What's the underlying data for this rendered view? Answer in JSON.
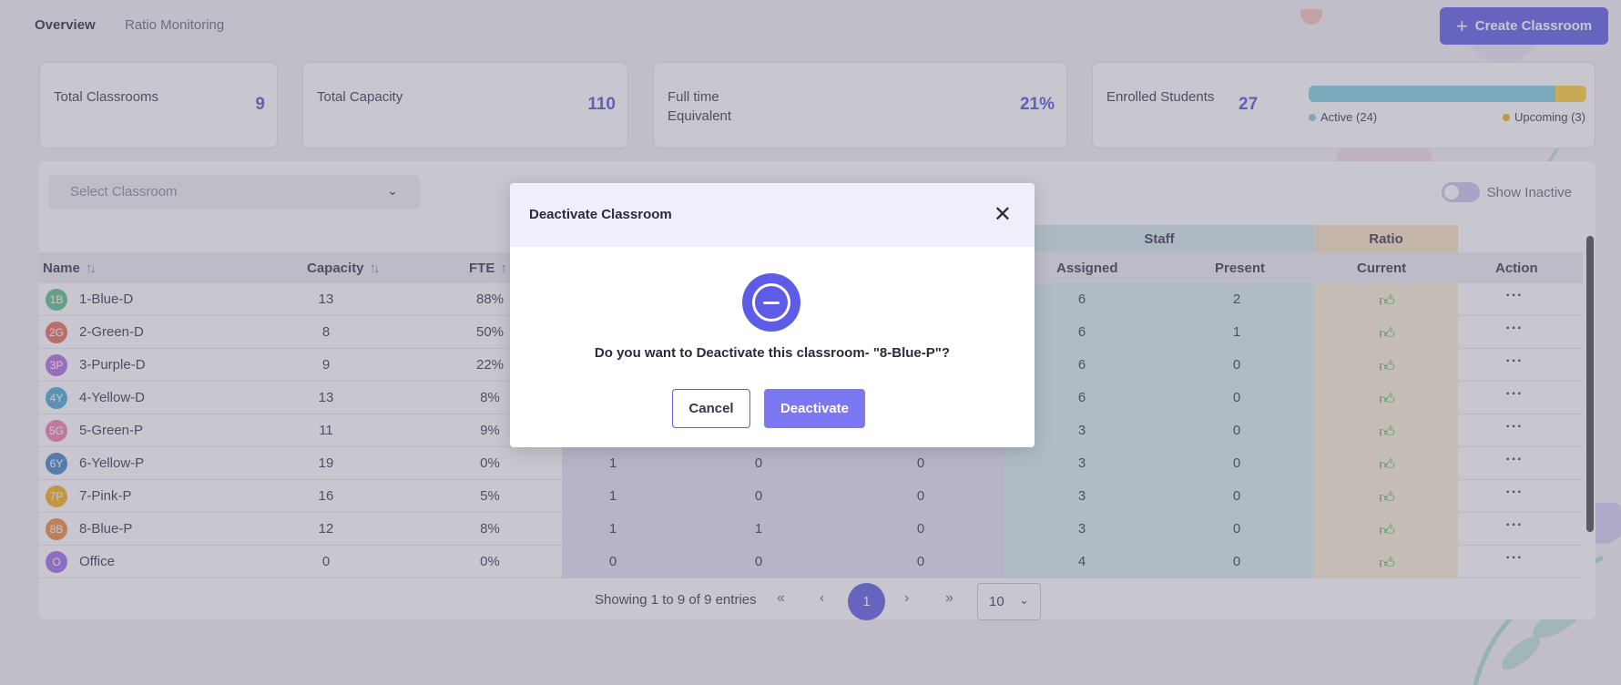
{
  "tabs": [
    {
      "label": "Overview",
      "active": true
    },
    {
      "label": "Ratio Monitoring",
      "active": false
    }
  ],
  "create_button": {
    "label": "Create Classroom",
    "icon": "plus-icon"
  },
  "stats": {
    "total_classrooms": {
      "label": "Total Classrooms",
      "value": "9"
    },
    "total_capacity": {
      "label": "Total Capacity",
      "value": "110"
    },
    "fte": {
      "label": "Full time Equivalent",
      "value": "21%"
    },
    "enrolled": {
      "label": "Enrolled Students",
      "value": "27",
      "active_label": "Active (24)",
      "upcoming_label": "Upcoming (3)",
      "active": 24,
      "upcoming": 3,
      "colors": {
        "active": "#7fd0e3",
        "upcoming": "#ffcf34"
      }
    }
  },
  "filter": {
    "placeholder": "Select Classroom",
    "show_inactive_label": "Show Inactive",
    "show_inactive": false
  },
  "table": {
    "group_headers": {
      "staff": "Staff",
      "ratio": "Ratio"
    },
    "columns": {
      "name": "Name",
      "capacity": "Capacity",
      "fte": "FTE",
      "assigned": "Assigned",
      "present": "Present",
      "current": "Current",
      "action": "Action"
    },
    "rows": [
      {
        "badge": "1B",
        "badge_color": "#5dbf8a",
        "name": "1-Blue-D",
        "capacity": "13",
        "fte": "88%",
        "c1": "",
        "c2": "",
        "c3": "",
        "assigned": "6",
        "present": "2"
      },
      {
        "badge": "2G",
        "badge_color": "#e76d5a",
        "name": "2-Green-D",
        "capacity": "8",
        "fte": "50%",
        "c1": "",
        "c2": "",
        "c3": "",
        "assigned": "6",
        "present": "1"
      },
      {
        "badge": "3P",
        "badge_color": "#b06be0",
        "name": "3-Purple-D",
        "capacity": "9",
        "fte": "22%",
        "c1": "",
        "c2": "",
        "c3": "",
        "assigned": "6",
        "present": "0"
      },
      {
        "badge": "4Y",
        "badge_color": "#4aa9d6",
        "name": "4-Yellow-D",
        "capacity": "13",
        "fte": "8%",
        "c1": "",
        "c2": "",
        "c3": "",
        "assigned": "6",
        "present": "0"
      },
      {
        "badge": "5G",
        "badge_color": "#f27fb0",
        "name": "5-Green-P",
        "capacity": "11",
        "fte": "9%",
        "c1": "",
        "c2": "",
        "c3": "",
        "assigned": "3",
        "present": "0"
      },
      {
        "badge": "6Y",
        "badge_color": "#3e84c8",
        "name": "6-Yellow-P",
        "capacity": "19",
        "fte": "0%",
        "c1": "1",
        "c2": "0",
        "c3": "0",
        "assigned": "3",
        "present": "0"
      },
      {
        "badge": "7P",
        "badge_color": "#f2b21b",
        "name": "7-Pink-P",
        "capacity": "16",
        "fte": "5%",
        "c1": "1",
        "c2": "0",
        "c3": "0",
        "assigned": "3",
        "present": "0"
      },
      {
        "badge": "8B",
        "badge_color": "#f08a3a",
        "name": "8-Blue-P",
        "capacity": "12",
        "fte": "8%",
        "c1": "1",
        "c2": "1",
        "c3": "0",
        "assigned": "3",
        "present": "0"
      },
      {
        "badge": "O",
        "badge_color": "#9b6ee8",
        "name": "Office",
        "capacity": "0",
        "fte": "0%",
        "c1": "0",
        "c2": "0",
        "c3": "0",
        "assigned": "4",
        "present": "0"
      }
    ]
  },
  "pagination": {
    "info": "Showing 1 to 9 of 9 entries",
    "first": "«",
    "prev": "‹",
    "next": "›",
    "last": "»",
    "current_page": "1",
    "page_size": "10"
  },
  "modal": {
    "title": "Deactivate Classroom",
    "message": "Do you want to Deactivate this classroom- \"8-Blue-P\"?",
    "cancel_label": "Cancel",
    "confirm_label": "Deactivate",
    "accent": "#5e5ce6"
  }
}
